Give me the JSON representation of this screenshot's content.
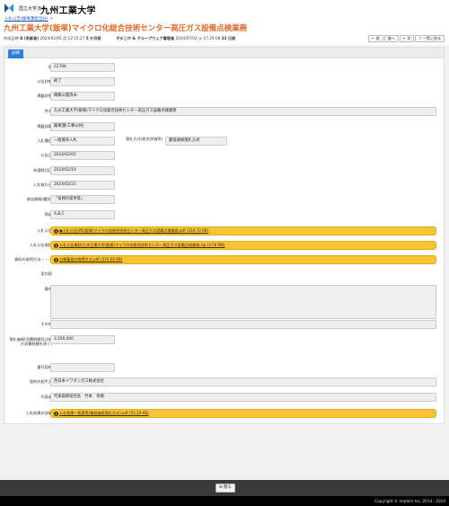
{
  "header": {
    "logo_small": "国立大学法人",
    "logo_big": "九州工業大学",
    "breadcrumb": "入札公告(飯塚課担当分)",
    "breadcrumb_sep": ">",
    "title": "九州工業大学(飯塚)マイクロ化総合技術センター高圧ガス設備点検業務",
    "created_label": "作成日時",
    "created_by": "A (系飯者)",
    "created_date": "2024/02/05 月 12:15:27",
    "created_ago": "5 か月前",
    "updated_label": "更新日時",
    "updated_by": "& グループウェア管理者",
    "updated_date": "2024/07/02 火 17:25:08",
    "updated_ago": "23 日前"
  },
  "toolbar": {
    "buttons": [
      "← 前",
      "後へ",
      "← 次",
      "↑ 一覧に戻る"
    ]
  },
  "tabs": {
    "active": "詳細"
  },
  "fields": {
    "id": {
      "label": "ID",
      "value": "22784"
    },
    "status": {
      "label": "公告状態",
      "value": "終了"
    },
    "publish": {
      "label": "掲載状態",
      "value": "掲載公開済み"
    },
    "subject": {
      "label": "件名",
      "value": "九州工業大学(飯塚)マイクロ化総合技術センター高圧ガス設備点検業務"
    },
    "category": {
      "label": "掲載部署",
      "value": "飯塚課(工事公共)"
    },
    "bid_type": {
      "label": "入札種別",
      "value": "一般競争入札"
    },
    "award_method": {
      "label": "落札方式(総合評価等)",
      "value": "最低価格落札方式"
    },
    "notice_date": {
      "label": "公告日",
      "value": "2024/02/05"
    },
    "deadline": {
      "label": "申請締切日",
      "value": "2024/02/19"
    },
    "bid_date": {
      "label": "入札執行日",
      "value": "2024/02/21"
    },
    "qualification": {
      "label": "参加資格(種別)",
      "value": "「役務の提供等」"
    },
    "grade": {
      "label": "等級",
      "value": "A,B,C"
    },
    "notice_file": {
      "label": "入札公告",
      "file": "●入札公告(PD)飯塚)マイクロ化総合技術センター高圧ガス設備点検業務.pdf (334.73 KB)"
    },
    "spec_file": {
      "label": "入札公告資料",
      "file": "入札公告資料(九州工業大学(飯塚)マイクロ化総合技術センター高圧ガス設備点検業務.zip (3.56 MB)"
    },
    "q_file": {
      "label": "資料の取得方法・・・",
      "file": "公開審査の取得方法.pdf (324.64 KB)"
    },
    "closed_reason": {
      "label": "案内容",
      "value": ""
    },
    "remarks": {
      "label": "備考",
      "value": ""
    },
    "other": {
      "label": "その他",
      "value": ""
    },
    "price": {
      "label": "落札価格(消費税額及び地方消費税額を除く)",
      "value": "3,160,000"
    },
    "contract_date": {
      "label": "番号契約",
      "value": ""
    },
    "contractor": {
      "label": "契約の相手方",
      "value": "西日本イワタニガス株式会社"
    },
    "representative": {
      "label": "代表者",
      "value": "代表取締役社長　竹本　秀樹"
    },
    "result_file": {
      "label": "入札結果の詳細",
      "file": "入札結果一覧表等(最低価格落札方式).pdf (55.29 KB)"
    }
  },
  "footer": {
    "close_label": "閉る",
    "copyright": "Copyright © Implem Inc. 2014 - 2024"
  },
  "colors": {
    "title": "#e16a2a",
    "tab": "#2a7de1",
    "attachment": "#f7c533"
  }
}
